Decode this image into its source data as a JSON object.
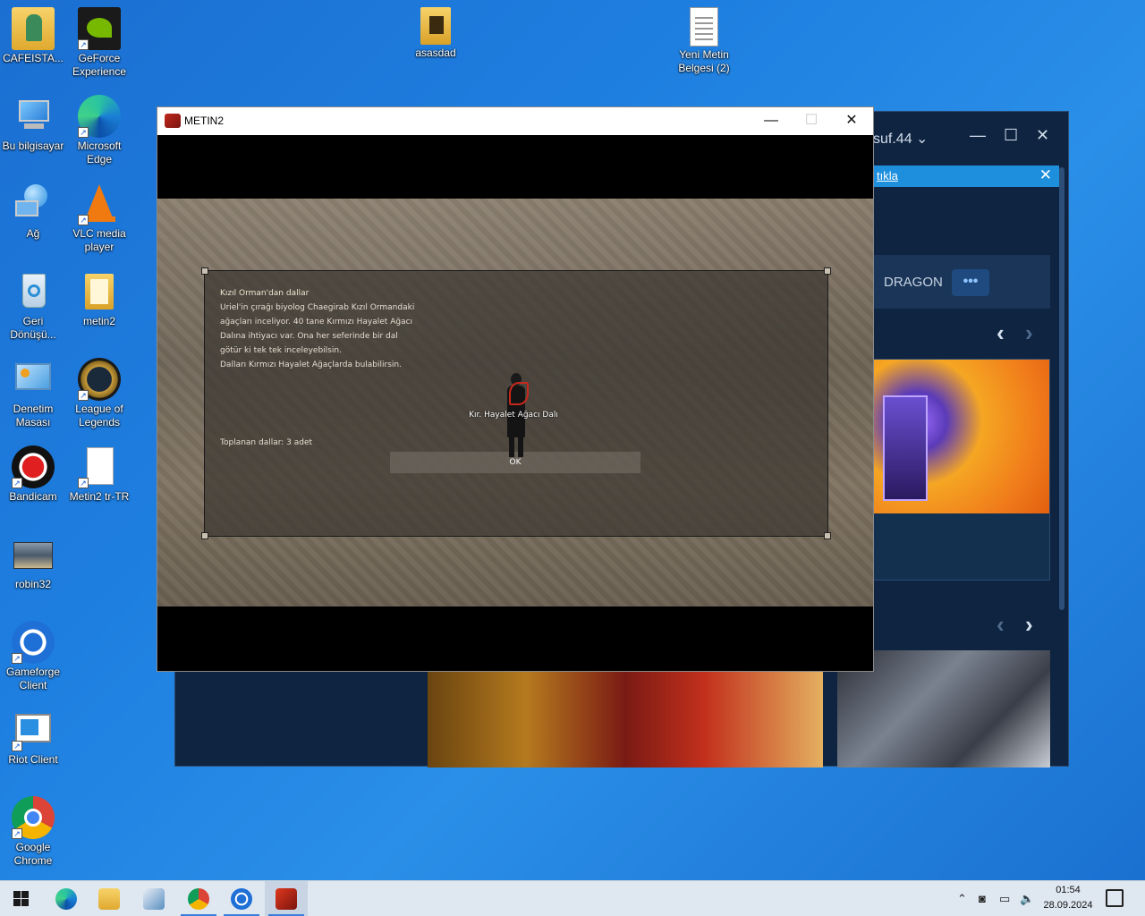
{
  "desktop": {
    "icons": [
      {
        "label": "CAFEISTA...",
        "icon": "folder-user-icon"
      },
      {
        "label": "GeForce Experience",
        "icon": "nvidia-icon"
      },
      {
        "label": "asasdad",
        "icon": "folder-icon"
      },
      {
        "label": "Yeni Metin Belgesi (2)",
        "icon": "text-document-icon"
      },
      {
        "label": "Bu bilgisayar",
        "icon": "computer-icon"
      },
      {
        "label": "Microsoft Edge",
        "icon": "edge-icon"
      },
      {
        "label": "Ağ",
        "icon": "network-icon"
      },
      {
        "label": "VLC media player",
        "icon": "vlc-icon"
      },
      {
        "label": "Geri Dönüşü...",
        "icon": "recycle-bin-icon"
      },
      {
        "label": "metin2",
        "icon": "folder-icon"
      },
      {
        "label": "Denetim Masası",
        "icon": "control-panel-icon"
      },
      {
        "label": "League of Legends",
        "icon": "league-icon"
      },
      {
        "label": "Bandicam",
        "icon": "bandicam-icon"
      },
      {
        "label": "Metin2 tr-TR",
        "icon": "file-icon"
      },
      {
        "label": "robin32",
        "icon": "image-icon"
      },
      {
        "label": "Gameforge Client",
        "icon": "gameforge-icon"
      },
      {
        "label": "Riot Client",
        "icon": "riot-icon"
      },
      {
        "label": "Google Chrome",
        "icon": "chrome-icon"
      }
    ]
  },
  "gameforge": {
    "user": "suf.44",
    "banner_link": "tıkla",
    "tab_dragon": "DRAGON",
    "tab_more": "•••"
  },
  "metin2": {
    "title": "METIN2",
    "minimize": "—",
    "maximize": "☐",
    "close": "✕",
    "quest": {
      "title": "Kızıl Orman'dan dallar",
      "lines": [
        "Uriel'in çırağı biyolog Chaegirab Kızıl Ormandaki",
        "ağaçları inceliyor. 40 tane Kırmızı Hayalet Ağacı",
        "Dalına ihtiyacı var. Ona her seferinde bir dal",
        "götür ki tek tek inceleyebilsin.",
        "Dalları Kırmızı Hayalet Ağaçlarda bulabilirsin."
      ],
      "collected": "Toplanan dallar: 3 adet",
      "ok": "OK"
    },
    "character_name": "Kır. Hayalet Ağacı Dalı"
  },
  "taskbar": {
    "items": [
      "start-icon",
      "edge-icon",
      "file-explorer-icon",
      "control-panel-icon",
      "chrome-icon",
      "gameforge-icon",
      "metin2-icon"
    ],
    "time": "01:54",
    "date": "28.09.2024"
  }
}
